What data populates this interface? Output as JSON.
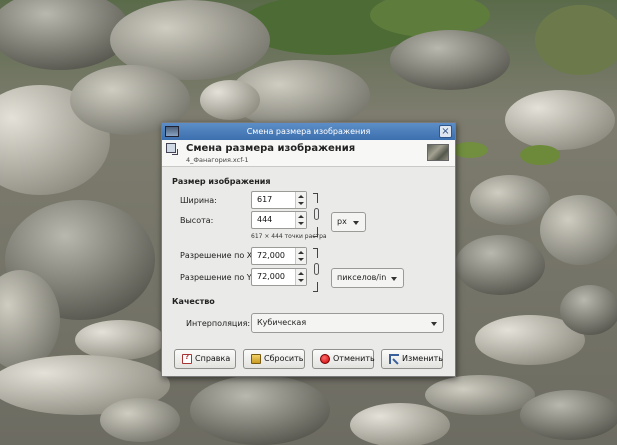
{
  "dialog": {
    "title": "Смена размера изображения",
    "header": {
      "title": "Смена размера изображения",
      "subtitle": "4_Фанагория.xcf-1"
    },
    "image_size": {
      "section_label": "Размер изображения",
      "width_label": "Ширина:",
      "width_value": "617",
      "height_label": "Высота:",
      "height_value": "444",
      "size_hint": "617 × 444 точки растра",
      "unit": "px",
      "xres_label": "Разрешение по X:",
      "xres_value": "72,000",
      "yres_label": "Разрешение по Y:",
      "yres_value": "72,000",
      "res_unit": "пикселов/in"
    },
    "quality": {
      "section_label": "Качество",
      "interp_label": "Интерполяция:",
      "interp_value": "Кубическая"
    },
    "buttons": {
      "help": "Справка",
      "reset": "Сбросить",
      "cancel": "Отменить",
      "resize": "Изменить"
    }
  },
  "icons": {
    "app": "gimp-app-icon",
    "close": "close-icon",
    "header": "scale-image-icon",
    "chain": "chain-link-icon",
    "help": "help-icon",
    "reset": "reset-icon",
    "cancel": "cancel-icon",
    "resize": "resize-icon"
  },
  "colors": {
    "titlebar": "#4a7dbb",
    "dialog_bg": "#eaeae8"
  }
}
